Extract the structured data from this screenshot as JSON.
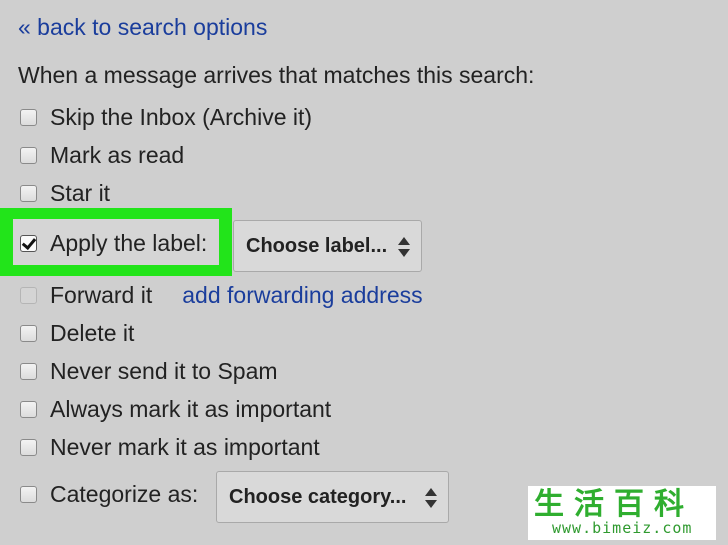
{
  "back_link": "« back to search options",
  "intro": "When a message arrives that matches this search:",
  "options": [
    {
      "label": "Skip the Inbox (Archive it)",
      "checked": false
    },
    {
      "label": "Mark as read",
      "checked": false
    },
    {
      "label": "Star it",
      "checked": false
    },
    {
      "label": "Apply the label:",
      "checked": true
    },
    {
      "label": "Forward it",
      "checked": false,
      "disabled": true
    },
    {
      "label": "Delete it",
      "checked": false
    },
    {
      "label": "Never send it to Spam",
      "checked": false
    },
    {
      "label": "Always mark it as important",
      "checked": false
    },
    {
      "label": "Never mark it as important",
      "checked": false
    },
    {
      "label": "Categorize as:",
      "checked": false
    }
  ],
  "label_select": "Choose label...",
  "forward_link": "add forwarding address",
  "category_select": "Choose category...",
  "watermark": {
    "chars": [
      "生",
      "活",
      "百",
      "科"
    ],
    "url": "www.bimeiz.com"
  },
  "colors": {
    "highlight": "#22e41a",
    "link": "#1a3d9c",
    "background": "#cfcfcf"
  }
}
